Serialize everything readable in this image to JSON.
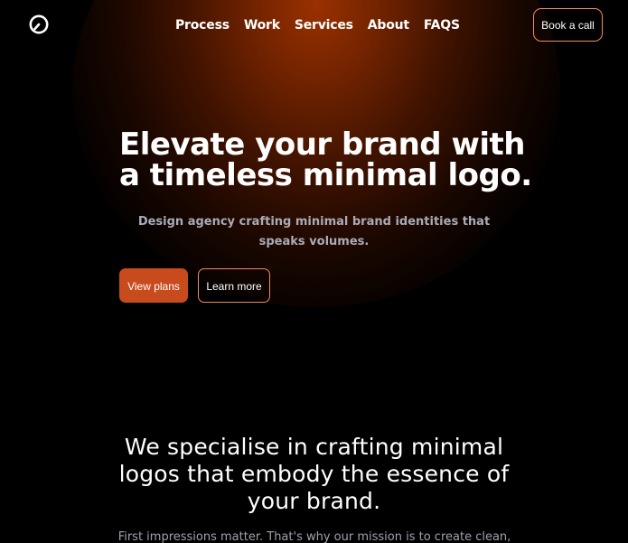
{
  "colors": {
    "background": "#000000",
    "glow": "#9d3200",
    "accent": "#c84b1d",
    "accent_border": "#f28a5f",
    "muted_text": "#a9abb6"
  },
  "header": {
    "logo_icon": "clock-logo-icon",
    "nav": [
      {
        "label": "Process"
      },
      {
        "label": "Work"
      },
      {
        "label": "Services"
      },
      {
        "label": "About"
      },
      {
        "label": "FAQS"
      }
    ],
    "cta_label": "Book a call"
  },
  "hero": {
    "title": "Elevate your brand with a timeless minimal logo.",
    "subtitle": "Design agency crafting minimal brand identities that speaks volumes.",
    "primary_button": "View plans",
    "secondary_button": "Learn more"
  },
  "section": {
    "title": "We specialise in crafting minimal logos that embody the essence of your brand.",
    "body": "First impressions matter. That's why our mission is to create clean,"
  }
}
